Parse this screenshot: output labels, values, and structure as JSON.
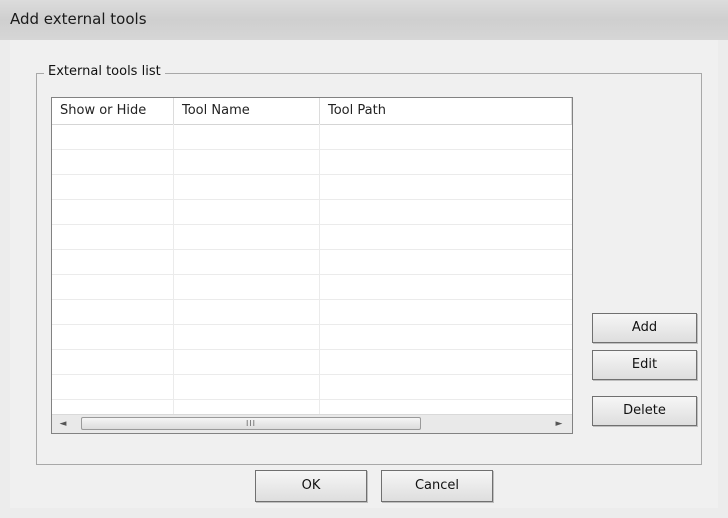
{
  "window": {
    "title": "Add external tools"
  },
  "group": {
    "label": "External tools list"
  },
  "table": {
    "columns": [
      "Show or Hide",
      "Tool Name",
      "Tool Path"
    ],
    "rows": []
  },
  "buttons": {
    "add": "Add",
    "edit": "Edit",
    "delete": "Delete",
    "ok": "OK",
    "cancel": "Cancel"
  },
  "scrollbar": {
    "left_arrow": "◄",
    "right_arrow": "►",
    "grip": "III"
  }
}
